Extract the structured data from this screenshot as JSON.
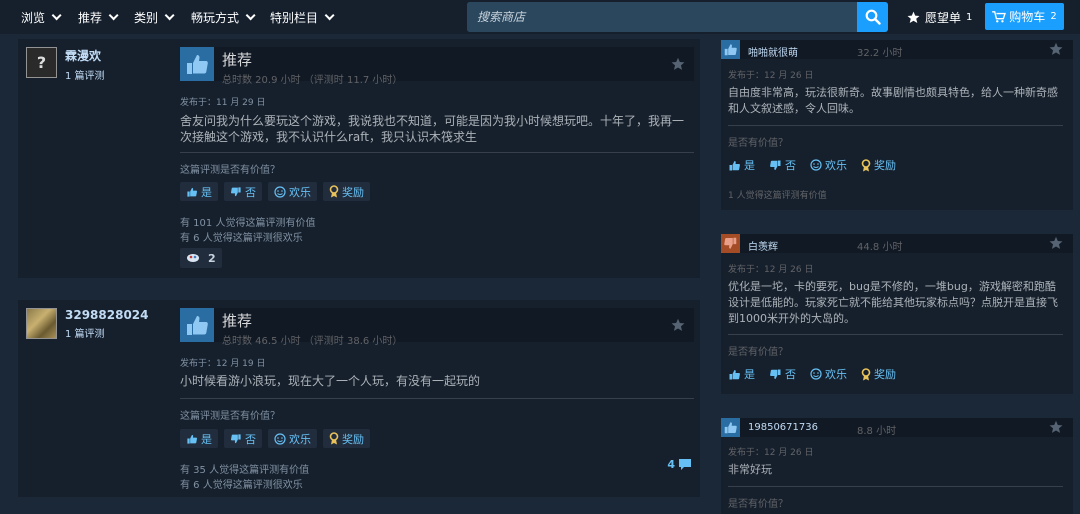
{
  "nav": {
    "items": [
      {
        "label": "浏览"
      },
      {
        "label": "推荐"
      },
      {
        "label": "类别"
      },
      {
        "label": "畅玩方式"
      },
      {
        "label": "特别栏目"
      }
    ],
    "search_placeholder": "搜索商店",
    "wishlist_label": "愿望单",
    "wishlist_count": "1",
    "cart_label": "购物车",
    "cart_count": "2"
  },
  "reviews": [
    {
      "author": "霖漫欢",
      "author_count": "1 篇评测",
      "avatar": "?",
      "verdict": "推荐",
      "hours": "总时数 20.9 小时  （评测时 11.7 小时）",
      "posted": "发布于：11 月 29 日",
      "content": "舍友问我为什么要玩这个游戏，我说我也不知道，可能是因为我小时候想玩吧。十年了，我再一次接触这个游戏，我不认识什么raft，我只认识木筏求生",
      "helpful_q": "这篇评测是否有价值？",
      "btn_yes": "是",
      "btn_no": "否",
      "btn_funny": "欢乐",
      "btn_award": "奖励",
      "stat1": "有 101 人觉得这篇评测有价值",
      "stat2": "有 6 人觉得这篇评测很欢乐",
      "award_count": "2"
    },
    {
      "author": "3298828024",
      "author_count": "1 篇评测",
      "verdict": "推荐",
      "hours": "总时数 46.5 小时  （评测时 38.6 小时）",
      "posted": "发布于：12 月 19 日",
      "content": "小时候看游小浪玩，现在大了一个人玩，有没有一起玩的",
      "helpful_q": "这篇评测是否有价值？",
      "btn_yes": "是",
      "btn_no": "否",
      "btn_funny": "欢乐",
      "btn_award": "奖励",
      "stat1": "有 35 人觉得这篇评测有价值",
      "stat2": "有 6 人觉得这篇评测很欢乐",
      "comment_count": "4"
    }
  ],
  "side_reviews": [
    {
      "author": "啪啪就很萌",
      "hours": "32.2 小时",
      "posted": "发布于：12 月 26 日",
      "content": "自由度非常高，玩法很新奇。故事剧情也颇具特色，给人一种新奇感和人文叙述感，令人回味。",
      "helpful_q": "是否有价值？",
      "btn_yes": "是",
      "btn_no": "否",
      "btn_funny": "欢乐",
      "btn_award": "奖励",
      "stat": "1 人觉得这篇评测有价值"
    },
    {
      "author": "白羡辉",
      "hours": "44.8 小时",
      "posted": "发布于：12 月 26 日",
      "content": "优化是一坨，卡的要死，bug是不修的，一堆bug，游戏解密和跑酷设计是低能的。玩家死亡就不能给其他玩家标点吗？点脱开是直接飞到1000米开外的大岛的。",
      "helpful_q": "是否有价值？",
      "btn_yes": "是",
      "btn_no": "否",
      "btn_funny": "欢乐",
      "btn_award": "奖励"
    },
    {
      "author": "19850671736",
      "hours": "8.8 小时",
      "posted": "发布于：12 月 26 日",
      "content": "非常好玩",
      "helpful_q": "是否有价值？"
    }
  ]
}
